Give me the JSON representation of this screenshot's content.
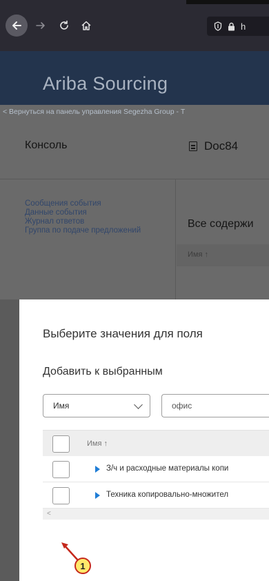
{
  "browser": {
    "icons": [
      "back-icon",
      "forward-icon",
      "reload-icon",
      "home-icon",
      "shield-icon",
      "lock-icon"
    ],
    "url_partial": "h",
    "colors": {
      "chrome": "#2b2a33",
      "back_button": "#5a5962"
    }
  },
  "app": {
    "title": "Ariba Sourcing",
    "back_link": "< Вернуться на панель управления Segezha Group - Т",
    "header_color": "#23344d"
  },
  "page": {
    "console_title": "Консоль",
    "doc_title": "Doc84",
    "side_links": [
      "Сообщения события",
      "Данные события",
      "Журнал ответов",
      "Группа по подаче предложений"
    ],
    "content_heading": "Все содержи",
    "table_header": "Имя ↑"
  },
  "dialog": {
    "title": "Выберите значения для поля",
    "section_title": "Добавить к выбранным",
    "filter_select": "Имя",
    "search_value": "офис",
    "column_header": "Имя ↑",
    "rows": [
      {
        "label": "З/ч и расходные материалы копи"
      },
      {
        "label": "Техника копировально-множител"
      }
    ],
    "scroll_left": "<",
    "accent_color": "#1f7dd6"
  },
  "annotation": {
    "badge": "1",
    "color": "#c5281c"
  }
}
